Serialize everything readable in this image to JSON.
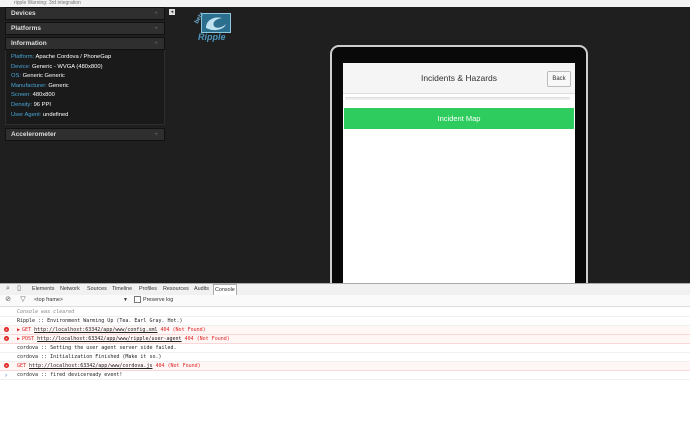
{
  "topbar": {
    "text": "ripple     Warning: 3rd integration"
  },
  "sidebar": {
    "collapse_icon": "◂",
    "panels": [
      {
        "title": "Devices",
        "toggle": "+"
      },
      {
        "title": "Platforms",
        "toggle": "+"
      },
      {
        "title": "Information",
        "toggle": "+"
      }
    ],
    "info": [
      {
        "key": "Platform:",
        "value": "Apache Cordova / PhoneGap"
      },
      {
        "key": "Device:",
        "value": "Generic - WVGA (480x800)"
      },
      {
        "key": "OS:",
        "value": "Generic Generic"
      },
      {
        "key": "Manufacturer:",
        "value": "Generic"
      },
      {
        "key": "Screen:",
        "value": "480x800"
      },
      {
        "key": "Density:",
        "value": "96 PPI"
      },
      {
        "key": "User Agent:",
        "value": "undefined"
      }
    ],
    "accelerometer": {
      "title": "Accelerometer",
      "toggle": "+"
    }
  },
  "logo": {
    "beta": "beta",
    "word": "Ripple"
  },
  "app": {
    "title": "Incidents & Hazards",
    "back_label": "Back",
    "map_button": "Incident Map",
    "accent": "#2ecc5f"
  },
  "devtools": {
    "tabs": [
      "Elements",
      "Network",
      "Sources",
      "Timeline",
      "Profiles",
      "Resources",
      "Audits",
      "Console"
    ],
    "active_tab": "Console",
    "frame": "<top frame>",
    "preserve_log": "Preserve log",
    "console": [
      {
        "type": "cleared",
        "text": "Console was cleared"
      },
      {
        "type": "log",
        "text": "Ripple :: Environment Warming Up (Tea. Earl Gray. Hot.)"
      },
      {
        "type": "error",
        "method": "GET",
        "url": "http://localhost:63342/app/www/config.xml",
        "status": "404 (Not Found)"
      },
      {
        "type": "error",
        "method": "POST",
        "url": "http://localhost:63342/app/www/ripple/user-agent",
        "status": "404 (Not Found)"
      },
      {
        "type": "log",
        "text": "cordova :: Setting the user agent server side failed."
      },
      {
        "type": "log",
        "text": "cordova :: Initialization Finished (Make it so.)"
      },
      {
        "type": "error",
        "method": "GET",
        "url": "http://localhost:63342/app/www/cordova.js",
        "status": "404 (Not Found)"
      },
      {
        "type": "log",
        "text": "cordova :: fired deviceready event!"
      }
    ],
    "prompt": "›"
  }
}
